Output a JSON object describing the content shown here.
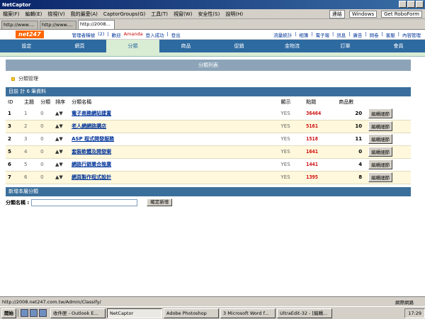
{
  "window": {
    "title": "NetCaptor"
  },
  "menu": {
    "items": [
      "檔案(F)",
      "編輯(E)",
      "檢視(V)",
      "我的最愛(A)",
      "CaptorGroups(G)",
      "工具(T)",
      "視窗(W)",
      "安全性(S)",
      "說明(H)"
    ],
    "toolbar": [
      "連結",
      "Windows",
      "Get RoboForm"
    ]
  },
  "tabs": [
    "http://www....",
    "http://www....",
    "http://2008..."
  ],
  "site": {
    "logo": "net247",
    "user_links": [
      "管理者稱號",
      "(2)",
      "|",
      "歡迎",
      "Amanda",
      "登入成功",
      "|",
      "登出"
    ],
    "top_links": [
      "流量統計",
      "|",
      "相簿",
      "|",
      "電子報",
      "|",
      "訊息",
      "|",
      "廣告",
      "|",
      "問卷",
      "|",
      "客服",
      "|",
      "內容管理"
    ],
    "nav": [
      "設定",
      "網頁",
      "分類",
      "商品",
      "促銷",
      "金物流",
      "訂單",
      "會員"
    ]
  },
  "list_title": "分類列表",
  "crumb": "分類管理",
  "list_header": "目前 計 6 筆資料",
  "columns": {
    "id": "ID",
    "main": "主題",
    "sub": "分類",
    "sort": "排序",
    "name": "分類名稱",
    "show": "顯示",
    "clicks": "點閱",
    "count": "商品數",
    "edit": ""
  },
  "rows": [
    {
      "id": "1",
      "main": "1",
      "sub": "0",
      "name": "電子商務網站建置",
      "show": "YES",
      "clicks": "36464",
      "count": "20",
      "edit": "編輯細節"
    },
    {
      "id": "3",
      "main": "2",
      "sub": "0",
      "name": "老人網網路購店",
      "show": "YES",
      "clicks": "5161",
      "count": "10",
      "edit": "編輯細節"
    },
    {
      "id": "2",
      "main": "3",
      "sub": "0",
      "name": "ASP 程式開發服務",
      "show": "YES",
      "clicks": "1518",
      "count": "11",
      "edit": "編輯細節"
    },
    {
      "id": "5",
      "main": "4",
      "sub": "0",
      "name": "套裝軟體及開發案",
      "show": "YES",
      "clicks": "1641",
      "count": "0",
      "edit": "編輯細節"
    },
    {
      "id": "6",
      "main": "5",
      "sub": "0",
      "name": "網路行銷業合推廣",
      "show": "YES",
      "clicks": "1441",
      "count": "4",
      "edit": "編輯細節"
    },
    {
      "id": "7",
      "main": "6",
      "sub": "0",
      "name": "網頁製作程式設計",
      "show": "YES",
      "clicks": "1395",
      "count": "8",
      "edit": "編輯細節"
    }
  ],
  "new_header": "新增本層分類",
  "new_form": {
    "label": "分類名稱 :",
    "value": "",
    "button": "確定新增"
  },
  "status": {
    "url": "http://2008.net247.com.tw/Admin/Classify/",
    "zone": "網際網路"
  },
  "taskbar": {
    "start": "開始",
    "tasks": [
      "收件匣 - Outlook E...",
      "NetCaptor",
      "Adobe Photoshop",
      "3 Microsoft Word f...",
      "UltraEdit-32 - [編輯..."
    ],
    "clock": "17:29"
  },
  "colors": {
    "nav": "#2d6aa0",
    "header": "#3b6f9b",
    "section": "#8da4b8",
    "clicks": "#cc0000",
    "logo": "#ff6600"
  }
}
